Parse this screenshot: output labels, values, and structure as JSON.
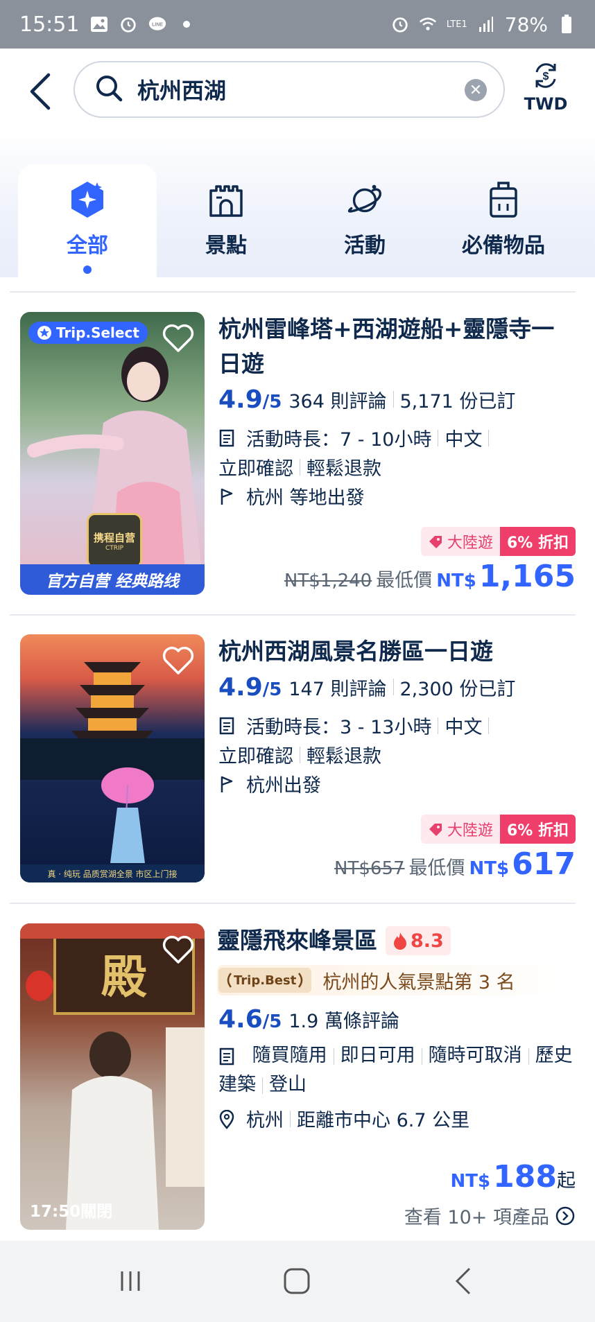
{
  "status_bar": {
    "time": "15:51",
    "battery": "78%",
    "network": "LTE1"
  },
  "header": {
    "search_query": "杭州西湖",
    "currency": "TWD"
  },
  "tabs": [
    {
      "label": "全部",
      "icon": "sparkle-icon",
      "active": true
    },
    {
      "label": "景點",
      "icon": "castle-icon",
      "active": false
    },
    {
      "label": "活動",
      "icon": "planet-icon",
      "active": false
    },
    {
      "label": "必備物品",
      "icon": "luggage-icon",
      "active": false
    }
  ],
  "products": [
    {
      "title": "杭州雷峰塔+西湖遊船+靈隱寺一日遊",
      "badge": "Trip.Select",
      "thumb_caption": "官方自营 经典路线",
      "thumb_logo": "携程自营",
      "thumb_logo_sub": "CTRIP",
      "score": "4.9",
      "score_of": "/5",
      "reviews": "364 則評論",
      "booked": "5,171 份已訂",
      "duration": "活動時長：7 - 10小時",
      "language": "中文",
      "confirm": "立即確認",
      "refund": "輕鬆退款",
      "departure": "杭州 等地出發",
      "promo_tag": "大陸遊",
      "discount": "6% 折扣",
      "old_price": "NT$1,240",
      "lowest_label": "最低價",
      "currency": "NT$",
      "price": "1,165"
    },
    {
      "title": "杭州西湖風景名勝區一日遊",
      "thumb_caption": "真 · 纯玩  品质赏湖全景  市区上门接",
      "score": "4.9",
      "score_of": "/5",
      "reviews": "147 則評論",
      "booked": "2,300 份已訂",
      "duration": "活動時長：3 - 13小時",
      "language": "中文",
      "confirm": "立即確認",
      "refund": "輕鬆退款",
      "departure": "杭州出發",
      "promo_tag": "大陸遊",
      "discount": "6% 折扣",
      "old_price": "NT$657",
      "lowest_label": "最低價",
      "currency": "NT$",
      "price": "617"
    },
    {
      "title": "靈隱飛來峰景區",
      "hot_score": "8.3",
      "best_badge": "Trip.Best",
      "ranking": "杭州的人氣景點第 3 名",
      "score": "4.6",
      "score_of": "/5",
      "reviews": "1.9 萬條評論",
      "tags": [
        "隨買隨用",
        "即日可用",
        "隨時可取消",
        "歷史建築",
        "登山"
      ],
      "city": "杭州",
      "distance": "距離市中心 6.7 公里",
      "close_time": "17:50關閉",
      "sign_text": "殿",
      "currency": "NT$",
      "price": "188",
      "price_suffix": "起",
      "more_link": "查看 10+ 項產品"
    }
  ]
}
